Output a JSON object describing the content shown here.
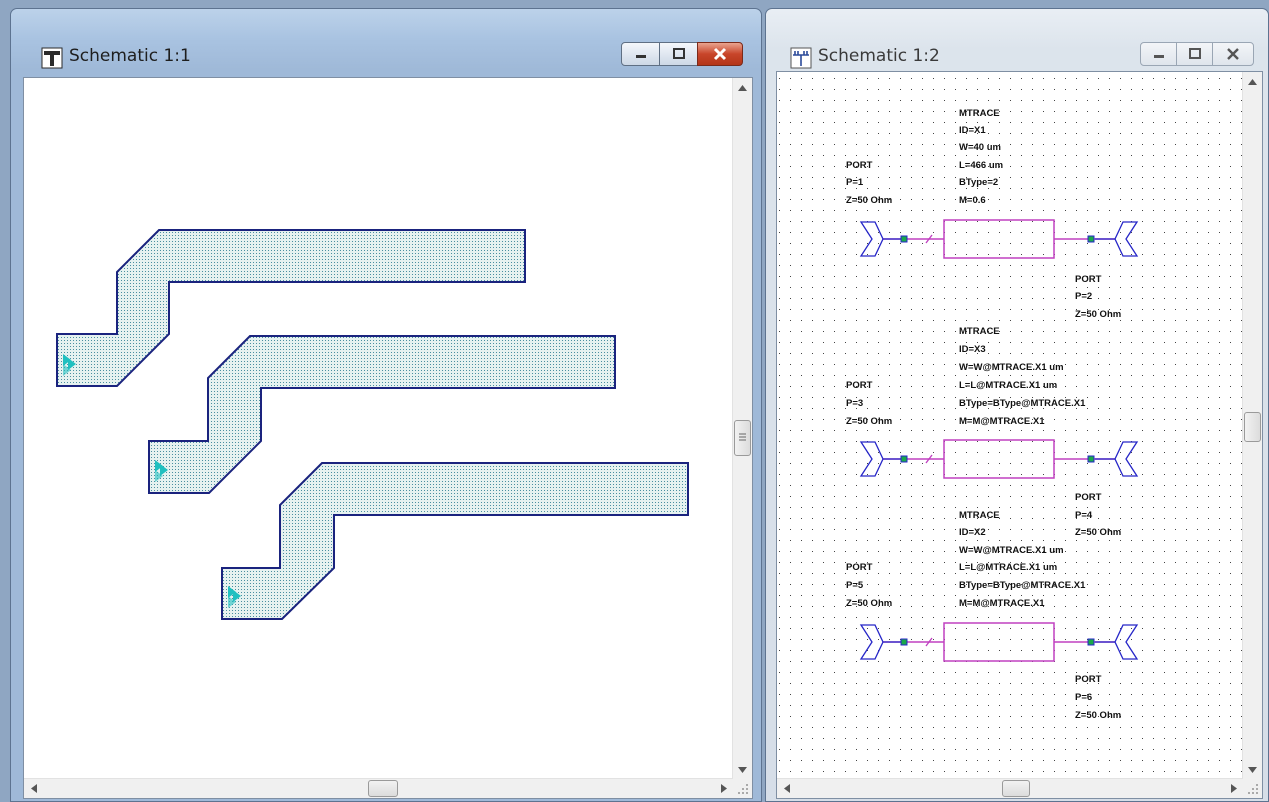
{
  "windows": [
    {
      "title": "Schematic 1:1",
      "icon": "layout-view-icon",
      "state": "active"
    },
    {
      "title": "Schematic 1:2",
      "icon": "schematic-view-icon",
      "state": "inactive"
    }
  ],
  "schematic": {
    "blocks": [
      {
        "trace": [
          "MTRACE",
          "ID=X1",
          "W=40 um",
          "L=466 um",
          "BType=2",
          "M=0.6"
        ],
        "port_in": [
          "PORT",
          "P=1",
          "Z=50 Ohm"
        ],
        "port_out": [
          "PORT",
          "P=2",
          "Z=50 Ohm"
        ]
      },
      {
        "trace": [
          "MTRACE",
          "ID=X3",
          "W=W@MTRACE.X1 um",
          "L=L@MTRACE.X1 um",
          "BType=BType@MTRACE.X1",
          "M=M@MTRACE.X1"
        ],
        "port_in": [
          "PORT",
          "P=3",
          "Z=50 Ohm"
        ],
        "port_out": [
          "PORT",
          "P=4",
          "Z=50 Ohm"
        ]
      },
      {
        "trace": [
          "MTRACE",
          "ID=X2",
          "W=W@MTRACE.X1 um",
          "L=L@MTRACE.X1 um",
          "BType=BType@MTRACE.X1",
          "M=M@MTRACE.X1"
        ],
        "port_in": [
          "PORT",
          "P=5",
          "Z=50 Ohm"
        ],
        "port_out": [
          "PORT",
          "P=6",
          "Z=50 Ohm"
        ]
      }
    ]
  },
  "colors": {
    "trace_fill": "#e6f2f0",
    "trace_outline": "#1a237e",
    "port_marker": "#20c0c0",
    "element_outline": "#c040c0",
    "port_outline": "#2626c8",
    "node": "#1aa84a"
  }
}
